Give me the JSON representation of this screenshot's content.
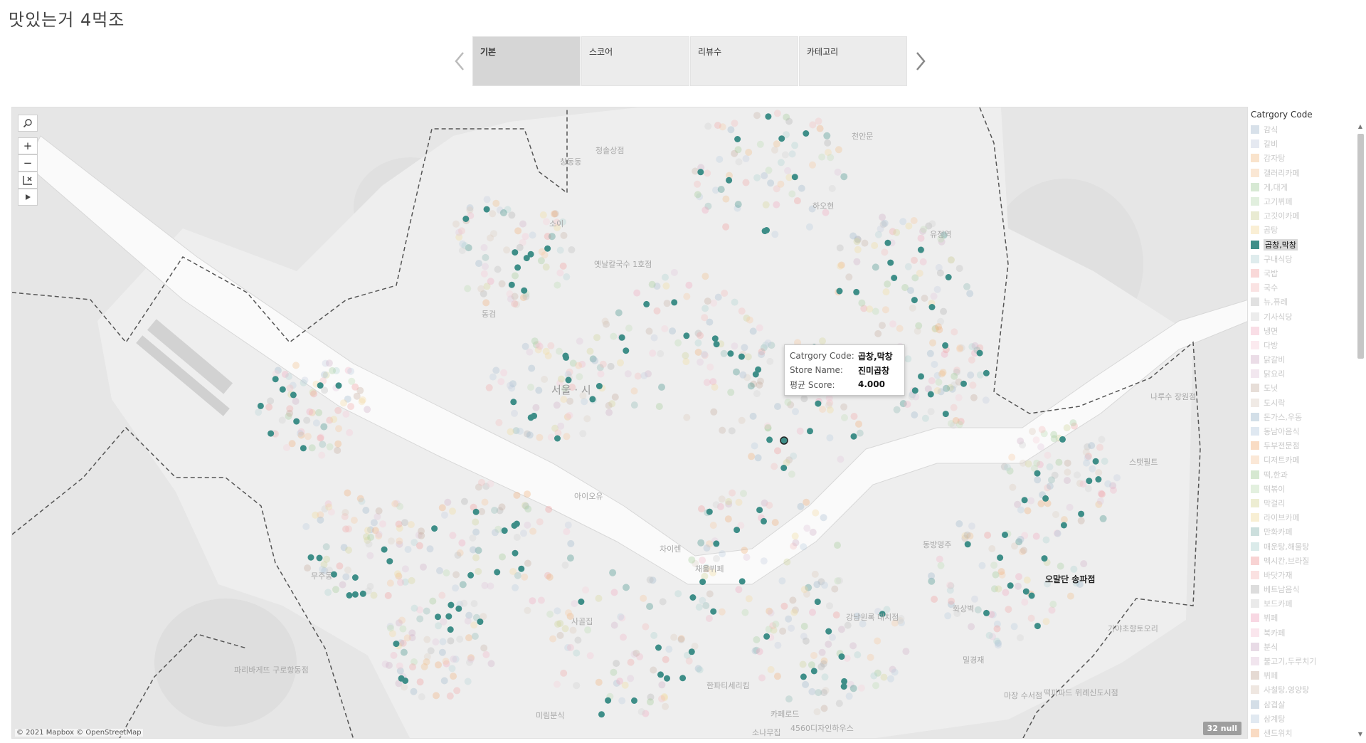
{
  "title": "맛있는거 4먹조",
  "tabs": [
    {
      "label": "기본",
      "active": true
    },
    {
      "label": "스코어",
      "active": false
    },
    {
      "label": "리뷰수",
      "active": false
    },
    {
      "label": "카테고리",
      "active": false
    }
  ],
  "nav": {
    "prev_icon": "chevron-left-icon",
    "next_icon": "chevron-right-icon"
  },
  "map_tools": {
    "search_icon": "search-icon",
    "zoom_in": "+",
    "zoom_out": "−",
    "reset_icon": "reset-axes-icon",
    "expand_icon": "play-icon"
  },
  "map_labels": [
    {
      "text": "창동동"
    },
    {
      "text": "청솔상점"
    },
    {
      "text": "천안문"
    },
    {
      "text": "소이"
    },
    {
      "text": "하오현"
    },
    {
      "text": "옛날칼국수 1호점"
    },
    {
      "text": "유정역"
    },
    {
      "text": "동검"
    },
    {
      "text": "서울 ·   시"
    },
    {
      "text": "나루수 장원점"
    },
    {
      "text": "스탯필트"
    },
    {
      "text": "아이오유"
    },
    {
      "text": "차이렌"
    },
    {
      "text": "채움뷔페"
    },
    {
      "text": "동방영주"
    },
    {
      "text": "오말단 송파점"
    },
    {
      "text": "무주동"
    },
    {
      "text": "사골집"
    },
    {
      "text": "강남원록 대치점"
    },
    {
      "text": "화상벽"
    },
    {
      "text": "가야초향토오리"
    },
    {
      "text": "파리바게뜨 구로항동점"
    },
    {
      "text": "밀경재"
    },
    {
      "text": "한파티세리킴"
    },
    {
      "text": "마장 수서점"
    },
    {
      "text": "떡파파드 위례신도시점"
    },
    {
      "text": "미림분식"
    },
    {
      "text": "카페로드"
    },
    {
      "text": "소나무집"
    },
    {
      "text": "4560디자인하우스"
    }
  ],
  "tooltip": {
    "rows": [
      {
        "key": "Catrgory Code:",
        "value": "곱창,막창"
      },
      {
        "key": "Store Name:",
        "value": "진미곱창"
      },
      {
        "key": "평균 Score:",
        "value": "4.000"
      }
    ]
  },
  "attribution": "© 2021 Mapbox © OpenStreetMap",
  "null_badge": "32 null",
  "legend": {
    "title": "Catrgory Code",
    "items": [
      {
        "label": "감식",
        "color": "#a9bcd0"
      },
      {
        "label": "갈비",
        "color": "#c5cfe0"
      },
      {
        "label": "감자탕",
        "color": "#f2c08d"
      },
      {
        "label": "갤러리카페",
        "color": "#f5c9a0"
      },
      {
        "label": "게,대게",
        "color": "#a7cfa0"
      },
      {
        "label": "고기뷔페",
        "color": "#bcdcb5"
      },
      {
        "label": "고깃이카페",
        "color": "#cfd39c"
      },
      {
        "label": "곰탕",
        "color": "#f3dba2"
      },
      {
        "label": "곱창,막창",
        "color": "#3e8e88",
        "highlight": true
      },
      {
        "label": "구내식당",
        "color": "#b8d4d6"
      },
      {
        "label": "국밥",
        "color": "#f2a9a9"
      },
      {
        "label": "국수",
        "color": "#f4c1c1"
      },
      {
        "label": "뉴,퓨레",
        "color": "#bdbdbd"
      },
      {
        "label": "기사식당",
        "color": "#d4d4d4"
      },
      {
        "label": "냉면",
        "color": "#f2b6c8"
      },
      {
        "label": "다방",
        "color": "#f7d0db"
      },
      {
        "label": "닭갈비",
        "color": "#d2b3c9"
      },
      {
        "label": "닭요리",
        "color": "#e3c9dc"
      },
      {
        "label": "도넛",
        "color": "#c9b5a8"
      },
      {
        "label": "도시락",
        "color": "#ddd0c6"
      },
      {
        "label": "돈가스,우동",
        "color": "#9db7cc"
      },
      {
        "label": "동남아음식",
        "color": "#b9cde0"
      },
      {
        "label": "두부전문점",
        "color": "#f2b27c"
      },
      {
        "label": "디저트카페",
        "color": "#f6cba6"
      },
      {
        "label": "떡,한과",
        "color": "#a3cc98"
      },
      {
        "label": "떡볶이",
        "color": "#c2deb9"
      },
      {
        "label": "막걸리",
        "color": "#d8d79b"
      },
      {
        "label": "라이브카페",
        "color": "#f0dc9f"
      },
      {
        "label": "만화카페",
        "color": "#8fb9b4"
      },
      {
        "label": "매운탕,해물탕",
        "color": "#b0d3d1"
      },
      {
        "label": "멕시칸,브라질",
        "color": "#f09d9d"
      },
      {
        "label": "바닷가재",
        "color": "#f4bdbd"
      },
      {
        "label": "베트남음식",
        "color": "#b3b3b3"
      },
      {
        "label": "보드카페",
        "color": "#d1d1d1"
      },
      {
        "label": "뷔페",
        "color": "#f0a8c0"
      },
      {
        "label": "북카페",
        "color": "#f5c8d6"
      },
      {
        "label": "분식",
        "color": "#cdb0c7"
      },
      {
        "label": "불고기,두루치기",
        "color": "#dfc6d9"
      },
      {
        "label": "뷔페",
        "color": "#c6ac9d"
      },
      {
        "label": "사철탕,영양탕",
        "color": "#dccabd"
      },
      {
        "label": "삼겹살",
        "color": "#9fb6ca"
      },
      {
        "label": "삼계탕",
        "color": "#bccfe0"
      },
      {
        "label": "샌드위치",
        "color": "#f2b07a"
      }
    ]
  }
}
